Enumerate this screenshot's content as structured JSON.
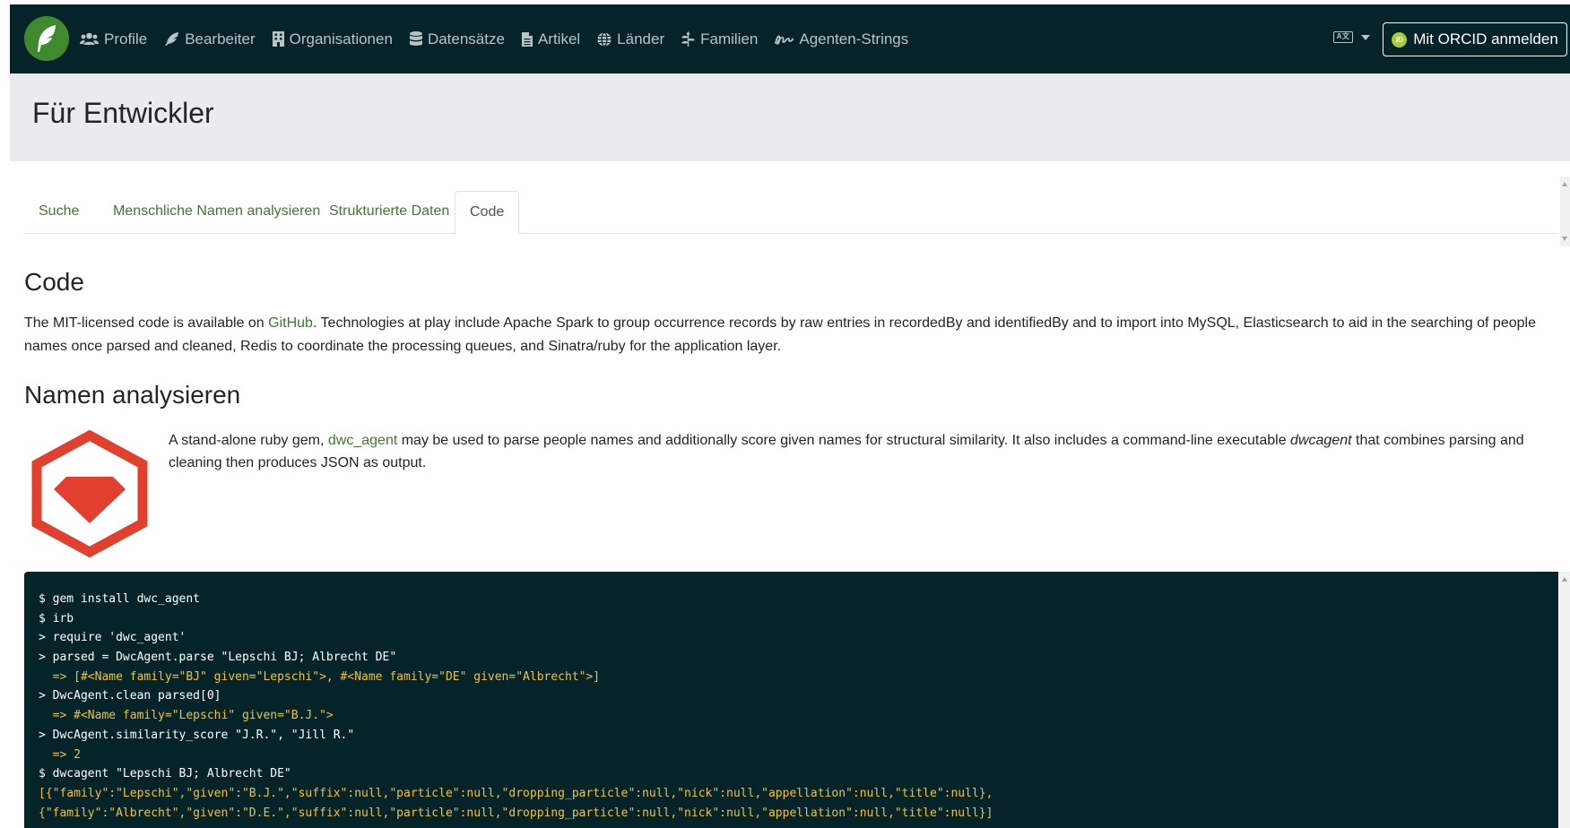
{
  "nav": {
    "items": [
      {
        "label": "Profile",
        "icon": "users-icon"
      },
      {
        "label": "Bearbeiter",
        "icon": "feather-icon"
      },
      {
        "label": "Organisationen",
        "icon": "building-icon"
      },
      {
        "label": "Datensätze",
        "icon": "database-icon"
      },
      {
        "label": "Artikel",
        "icon": "file-icon"
      },
      {
        "label": "Länder",
        "icon": "globe-icon"
      },
      {
        "label": "Familien",
        "icon": "plant-icon"
      },
      {
        "label": "Agenten-Strings",
        "icon": "signature-icon"
      }
    ],
    "language_icon_text": "A文",
    "orcid_button": "Mit ORCID anmelden",
    "orcid_icon_text": "iD"
  },
  "jumbotron": {
    "title": "Für Entwickler"
  },
  "tabs": [
    {
      "label": "Suche",
      "active": false
    },
    {
      "label": "Menschliche Namen analysieren",
      "active": false
    },
    {
      "label": "Strukturierte Daten",
      "active": false
    },
    {
      "label": "Code",
      "active": true
    }
  ],
  "code_section": {
    "heading": "Code",
    "text_before_link": "The MIT-licensed code is available on ",
    "link": "GitHub",
    "text_after_link": ". Technologies at play include Apache Spark to group occurrence records by raw entries in recordedBy and identifiedBy and to import into MySQL, Elasticsearch to aid in the searching of people names once parsed and cleaned, Redis to coordinate the processing queues, and Sinatra/ruby for the application layer."
  },
  "parse_section": {
    "heading": "Namen analysieren",
    "text_before_link": "A stand-alone ruby gem, ",
    "link": "dwc_agent",
    "text_mid": " may be used to parse people names and additionally score given names for structural similarity. It also includes a command-line executable ",
    "emphasis": "dwcagent",
    "text_end": " that combines parsing and cleaning then produces JSON as output."
  },
  "code_lines": [
    {
      "text": "$ gem install dwc_agent",
      "kind": "cmd"
    },
    {
      "text": "$ irb",
      "kind": "cmd"
    },
    {
      "text": "> require 'dwc_agent'",
      "kind": "cmd"
    },
    {
      "text": "> parsed = DwcAgent.parse \"Lepschi BJ; Albrecht DE\"",
      "kind": "cmd"
    },
    {
      "text": "  => [#<Name family=\"BJ\" given=\"Lepschi\">, #<Name family=\"DE\" given=\"Albrecht\">]",
      "kind": "out"
    },
    {
      "text": "> DwcAgent.clean parsed[0]",
      "kind": "cmd"
    },
    {
      "text": "  => #<Name family=\"Lepschi\" given=\"B.J.\">",
      "kind": "out"
    },
    {
      "text": "> DwcAgent.similarity_score \"J.R.\", \"Jill R.\"",
      "kind": "cmd"
    },
    {
      "text": "  => 2",
      "kind": "out"
    },
    {
      "text": "$ dwcagent \"Lepschi BJ; Albrecht DE\"",
      "kind": "cmd"
    },
    {
      "text": "[{\"family\":\"Lepschi\",\"given\":\"B.J.\",\"suffix\":null,\"particle\":null,\"dropping_particle\":null,\"nick\":null,\"appellation\":null,\"title\":null},",
      "kind": "out"
    },
    {
      "text": "{\"family\":\"Albrecht\",\"given\":\"D.E.\",\"suffix\":null,\"particle\":null,\"dropping_particle\":null,\"nick\":null,\"appellation\":null,\"title\":null}]",
      "kind": "out"
    }
  ],
  "colors": {
    "navbar": "#04242a",
    "link": "#3d7b2c",
    "ruby_red": "#e2402f",
    "code_output": "#f0c23b"
  }
}
